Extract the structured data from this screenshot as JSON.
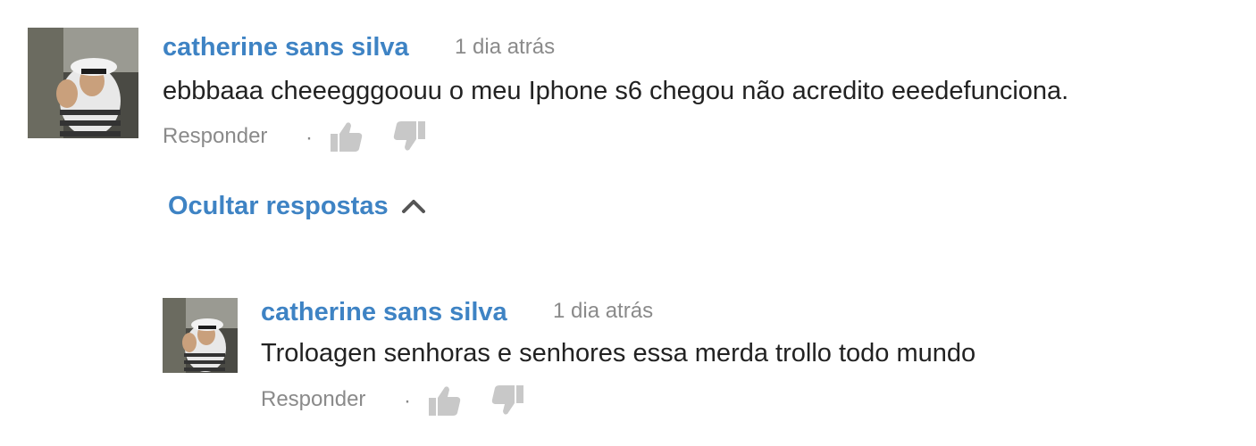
{
  "comment": {
    "author": "catherine sans silva",
    "timestamp": "1 dia atrás",
    "text": "ebbbaaa cheeegggoouu o meu Iphone s6 chegou não acredito eeedefunciona.",
    "reply_label": "Responder",
    "separator": "·",
    "icons": [
      "thumbs-up-icon",
      "thumbs-down-icon"
    ]
  },
  "toggle": {
    "label": "Ocultar respostas",
    "icon": "chevron-up-icon"
  },
  "reply": {
    "author": "catherine sans silva",
    "timestamp": "1 dia atrás",
    "text": "Troloagen senhoras e senhores essa merda trollo todo mundo",
    "reply_label": "Responder",
    "separator": "·",
    "icons": [
      "thumbs-up-icon",
      "thumbs-down-icon"
    ]
  },
  "colors": {
    "link_blue": "#3e83c4",
    "muted_gray": "#8a8a8a",
    "text": "#222222",
    "icon_gray": "#c8c8c8"
  }
}
